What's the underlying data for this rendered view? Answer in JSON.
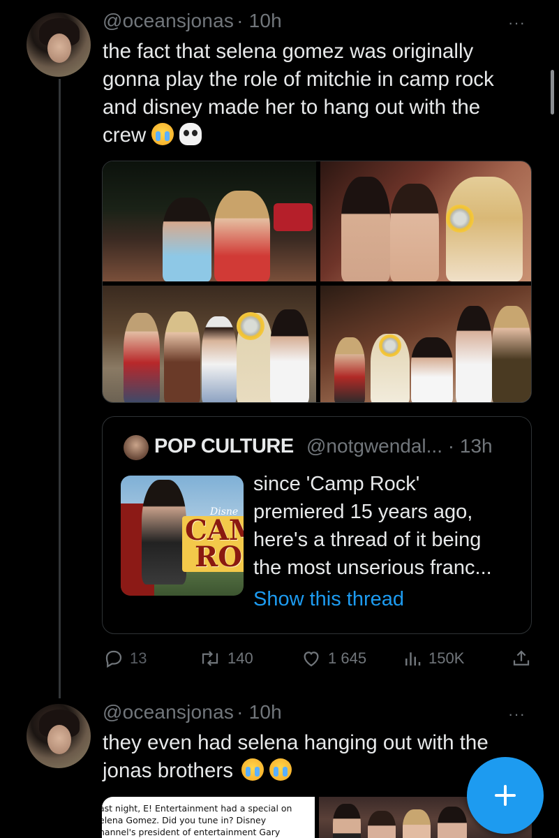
{
  "tweet1": {
    "handle": "@oceansjonas",
    "time": "· 10h",
    "more": "···",
    "text": "the fact that selena gomez was originally gonna play the role of mitchie in camp rock and disney made her to hang out with the crew",
    "line1": "the fact that selena gomez was originally",
    "line2": "gonna play the role of mitchie in camp rock",
    "line3": "and disney made her to hang out with the",
    "line4": "crew",
    "emojis": [
      "loudly-crying-face",
      "skull"
    ]
  },
  "quote": {
    "name": "POP CULTURE",
    "handle": "@notgwendal... · 13h",
    "line1": "since 'Camp Rock'",
    "line2": "premiered 15 years ago,",
    "line3": "here's a thread of it being",
    "line4": "the most unserious franc...",
    "link": "Show this thread",
    "thumb_logo_1": "CAMI",
    "thumb_logo_2": "ROI",
    "thumb_disney": "Disne"
  },
  "actions": {
    "replies": "13",
    "retweets": "140",
    "likes": "1 645",
    "views": "150K"
  },
  "tweet2": {
    "handle": "@oceansjonas",
    "time": "· 10h",
    "more": "···",
    "line1": "they even had selena hanging out with the",
    "line2": "jonas brothers",
    "emojis": [
      "loudly-crying-face",
      "loudly-crying-face"
    ]
  },
  "news_snippet": {
    "line1": "ast night, E! Entertainment had a special on",
    "line2": "elena Gomez. Did you tune in? Disney",
    "line3": "hannel's president of entertainment Gary"
  },
  "colors": {
    "background": "#000000",
    "text": "#e7e9ea",
    "muted": "#71767b",
    "accent": "#1d9bf0",
    "border": "#2f3336"
  }
}
